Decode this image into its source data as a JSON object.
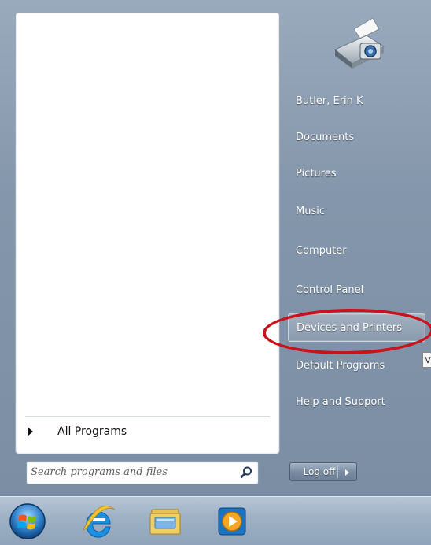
{
  "start_menu": {
    "all_programs_label": "All Programs",
    "search": {
      "placeholder": "Search programs and files"
    },
    "right_items": [
      {
        "label": "Butler, Erin K"
      },
      {
        "label": "Documents"
      },
      {
        "label": "Pictures"
      },
      {
        "label": "Music"
      },
      {
        "label": "Computer"
      },
      {
        "label": "Control Panel"
      },
      {
        "label": "Devices and Printers",
        "highlighted": true
      },
      {
        "label": "Default Programs"
      },
      {
        "label": "Help and Support"
      }
    ],
    "tooltip_fragment": "V",
    "logoff_label": "Log off"
  },
  "annotation": {
    "color": "#c8121c"
  },
  "taskbar": {
    "icons": [
      "windows-start-orb-icon",
      "internet-explorer-icon",
      "file-explorer-icon",
      "media-player-icon"
    ]
  }
}
